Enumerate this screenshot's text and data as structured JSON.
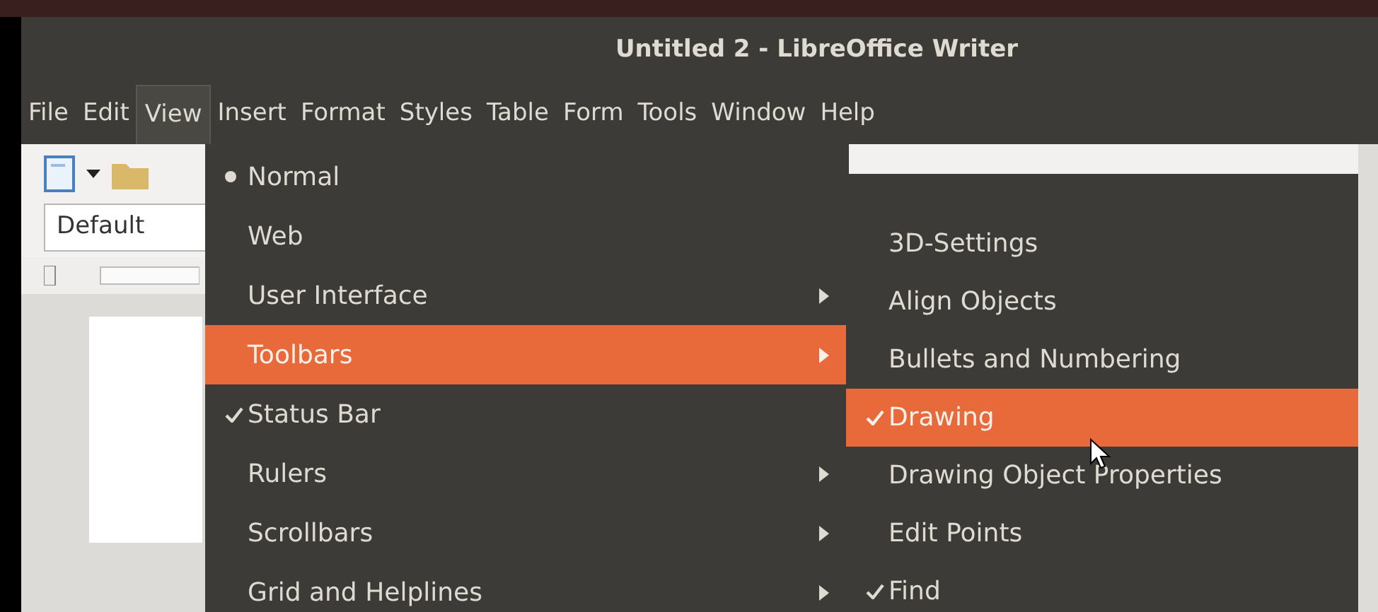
{
  "window": {
    "title": "Untitled 2 - LibreOffice Writer"
  },
  "menubar": [
    {
      "label": "File",
      "selected": false
    },
    {
      "label": "Edit",
      "selected": false
    },
    {
      "label": "View",
      "selected": true
    },
    {
      "label": "Insert",
      "selected": false
    },
    {
      "label": "Format",
      "selected": false
    },
    {
      "label": "Styles",
      "selected": false
    },
    {
      "label": "Table",
      "selected": false
    },
    {
      "label": "Form",
      "selected": false
    },
    {
      "label": "Tools",
      "selected": false
    },
    {
      "label": "Window",
      "selected": false
    },
    {
      "label": "Help",
      "selected": false
    }
  ],
  "toolbar": {
    "paragraph_style": "Default"
  },
  "view_menu": [
    {
      "label": "Normal",
      "kind": "radio",
      "checked": true,
      "selected": false
    },
    {
      "label": "Web",
      "kind": "radio",
      "checked": false,
      "selected": false
    },
    {
      "label": "User Interface",
      "kind": "submenu",
      "selected": false
    },
    {
      "label": "Toolbars",
      "kind": "submenu",
      "selected": true
    },
    {
      "label": "Status Bar",
      "kind": "check",
      "checked": true,
      "selected": false
    },
    {
      "label": "Rulers",
      "kind": "submenu",
      "selected": false
    },
    {
      "label": "Scrollbars",
      "kind": "submenu",
      "selected": false
    },
    {
      "label": "Grid and Helplines",
      "kind": "submenu",
      "selected": false
    }
  ],
  "toolbars_submenu": [
    {
      "label": "3D-Settings",
      "checked": false,
      "selected": false
    },
    {
      "label": "Align Objects",
      "checked": false,
      "selected": false
    },
    {
      "label": "Bullets and Numbering",
      "checked": false,
      "selected": false
    },
    {
      "label": "Drawing",
      "checked": true,
      "selected": true
    },
    {
      "label": "Drawing Object Properties",
      "checked": false,
      "selected": false
    },
    {
      "label": "Edit Points",
      "checked": false,
      "selected": false
    },
    {
      "label": "Find",
      "checked": true,
      "selected": false
    }
  ]
}
